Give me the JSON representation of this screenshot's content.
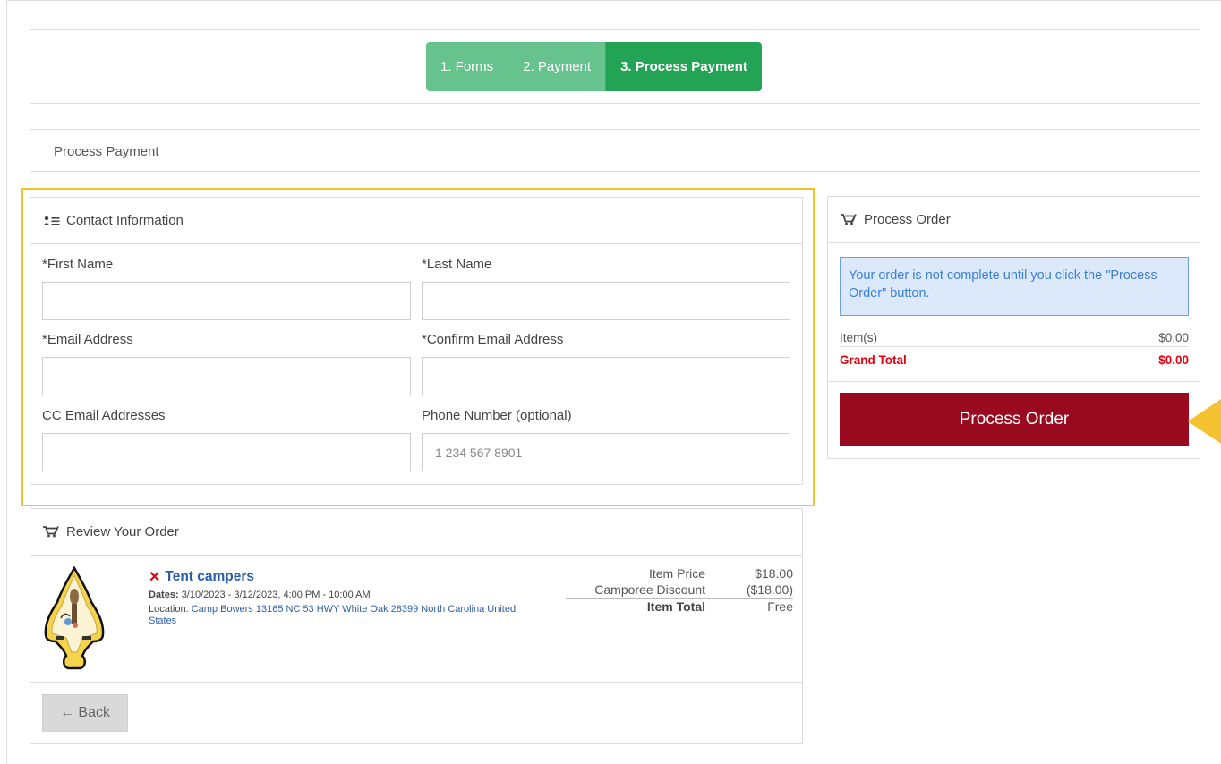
{
  "steps": [
    {
      "label": "1. Forms",
      "state": "done"
    },
    {
      "label": "2. Payment",
      "state": "done"
    },
    {
      "label": "3. Process Payment",
      "state": "active"
    }
  ],
  "breadcrumb": "Process Payment",
  "contact": {
    "header": "Contact Information",
    "header_icon": "contact-card-icon",
    "first_name_label": "*First Name",
    "first_name_value": "",
    "last_name_label": "*Last Name",
    "last_name_value": "",
    "email_label": "*Email Address",
    "email_value": "",
    "confirm_email_label": "*Confirm Email Address",
    "confirm_email_value": "",
    "cc_email_label": "CC Email Addresses",
    "cc_email_value": "",
    "phone_label": "Phone Number (optional)",
    "phone_placeholder": "1 234 567 8901"
  },
  "order": {
    "header": "Process Order",
    "header_icon": "cart-icon",
    "notice": "Your order is not complete until you click the \"Process Order\" button.",
    "items_label": "Item(s)",
    "items_value": "$0.00",
    "grand_total_label": "Grand Total",
    "grand_total_value": "$0.00",
    "process_button": "Process Order"
  },
  "review": {
    "header": "Review Your Order",
    "header_icon": "cart-icon",
    "item": {
      "title": "Tent campers",
      "dates_label": "Dates:",
      "dates_value": "3/10/2023 - 3/12/2023, 4:00 PM - 10:00 AM",
      "location_label": "Location:",
      "location_value": "Camp Bowers 13165 NC 53 HWY White Oak 28399 North Carolina United States",
      "price_label": "Item Price",
      "price_value": "$18.00",
      "discount_label": "Camporee Discount",
      "discount_value": "($18.00)",
      "total_label": "Item Total",
      "total_value": "Free"
    },
    "back_button": "← Back"
  },
  "colors": {
    "step_done": "#66c38e",
    "step_active": "#23a455",
    "process_button": "#990a1e",
    "highlight": "#f3c230",
    "grand_total": "#e3000f",
    "link": "#2a5fa8"
  }
}
